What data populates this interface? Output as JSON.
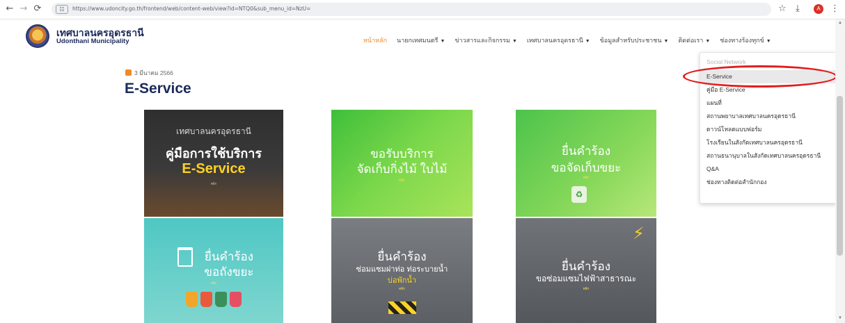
{
  "browser": {
    "url": "https://www.udoncity.go.th/frontend/web/content-web/view?id=NTQ0&sub_menu_id=NzU=",
    "back_icon": "←",
    "forward_icon": "→",
    "reload_icon": "⟳",
    "site_info_icon": "☷",
    "bookmark_icon": "☆",
    "download_icon": "⤓",
    "profile_initial": "A",
    "menu_icon": "⋮"
  },
  "site": {
    "name_th": "เทศบาลนครอุดรธานี",
    "name_en": "Udonthani Municipality"
  },
  "nav": {
    "items": [
      {
        "label": "หน้าหลัก",
        "dropdown": false,
        "active": true
      },
      {
        "label": "นายกเทศมนตรี",
        "dropdown": true,
        "active": false
      },
      {
        "label": "ข่าวสารและกิจกรรม",
        "dropdown": true,
        "active": false
      },
      {
        "label": "เทศบาลนครอุดรธานี",
        "dropdown": true,
        "active": false
      },
      {
        "label": "ข้อมูลสำหรับประชาชน",
        "dropdown": true,
        "active": false
      },
      {
        "label": "ติดต่อเรา",
        "dropdown": true,
        "active": false
      },
      {
        "label": "ช่องทางร้องทุกข์",
        "dropdown": true,
        "active": false
      }
    ],
    "caret": "▼"
  },
  "page": {
    "date": "3 มีนาคม 2566",
    "title": "E-Service"
  },
  "cards": [
    {
      "t1": "เทศบาลนครอุดรธานี",
      "t2": "คู่มือการใช้บริการ",
      "t3": "E-Service",
      "cta": "คลิก"
    },
    {
      "t1": "ขอรับบริการ",
      "t2": "จัดเก็บกิ่งไม้ ใบไม้",
      "cta": "คลิก"
    },
    {
      "t1": "ยื่นคำร้อง",
      "t2": "ขอจัดเก็บขยะ",
      "cta": "คลิก"
    },
    {
      "t1": "ยื่นคำร้อง",
      "t2": "ขอถังขยะ",
      "cta": "คลิก"
    },
    {
      "t1": "ยื่นคำร้อง",
      "t2": "ซ่อมแซมฝาท่อ ท่อระบายน้ำ",
      "t3": "บ่อพักน้ำ",
      "cta": "คลิก"
    },
    {
      "t1": "ยื่นคำร้อง",
      "t2": "ขอซ่อมแซมไฟฟ้าสาธารณะ",
      "cta": "คลิก"
    }
  ],
  "dropdown": {
    "header": "Social Network",
    "items": [
      "E-Service",
      "คู่มือ E-Service",
      "แผนที่",
      "สถานพยาบาลเทศบาลนครอุดรธานี",
      "ดาวน์โหลดแบบฟอร์ม",
      "โรงเรียนในสังกัดเทศบาลนครอุดรธานี",
      "สถานธนานุบาลในสังกัดเทศบาลนครอุดรธานี",
      "Q&A",
      "ช่องทางติดต่อสำนักกอง"
    ],
    "selected_index": 0
  },
  "colors": {
    "brand_navy": "#1b2a5a",
    "accent_orange": "#f08a24",
    "highlight_red": "#e21d1d"
  }
}
